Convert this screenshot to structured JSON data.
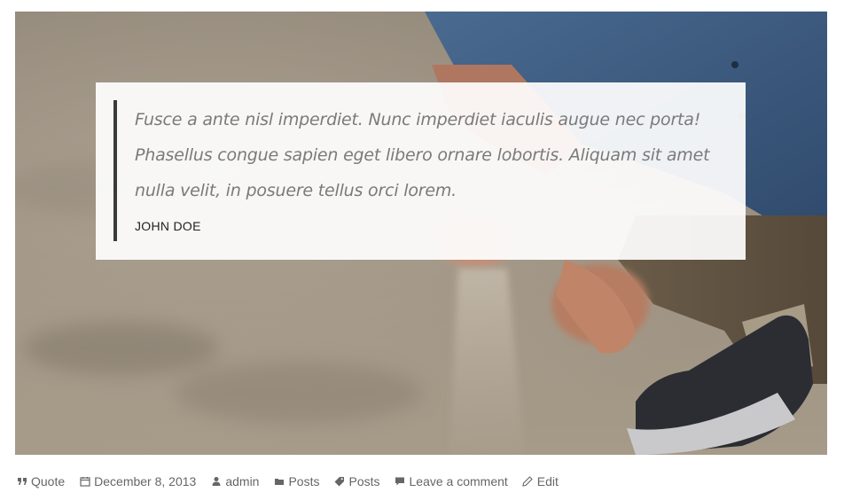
{
  "post": {
    "quote": {
      "text": "Fusce a ante nisl imperdiet. Nunc imperdiet iaculis augue nec porta! Phasellus congue sapien eget libero ornare lobortis. Aliquam sit amet nulla velit, in posuere tellus orci lorem.",
      "author": "JOHN DOE"
    },
    "meta": {
      "format": {
        "label": "Quote",
        "icon": "quote-icon"
      },
      "date": {
        "label": "December 8, 2013",
        "icon": "calendar-icon"
      },
      "author": {
        "label": "admin",
        "icon": "user-icon"
      },
      "category": {
        "label": "Posts",
        "icon": "folder-icon"
      },
      "tag": {
        "label": "Posts",
        "icon": "tag-icon"
      },
      "comments": {
        "label": "Leave a comment",
        "icon": "comment-icon"
      },
      "edit": {
        "label": "Edit",
        "icon": "pencil-icon"
      }
    }
  },
  "colors": {
    "meta_text": "#666666",
    "quote_text": "#7a7a7a",
    "quote_bar": "#3a3a3a"
  }
}
